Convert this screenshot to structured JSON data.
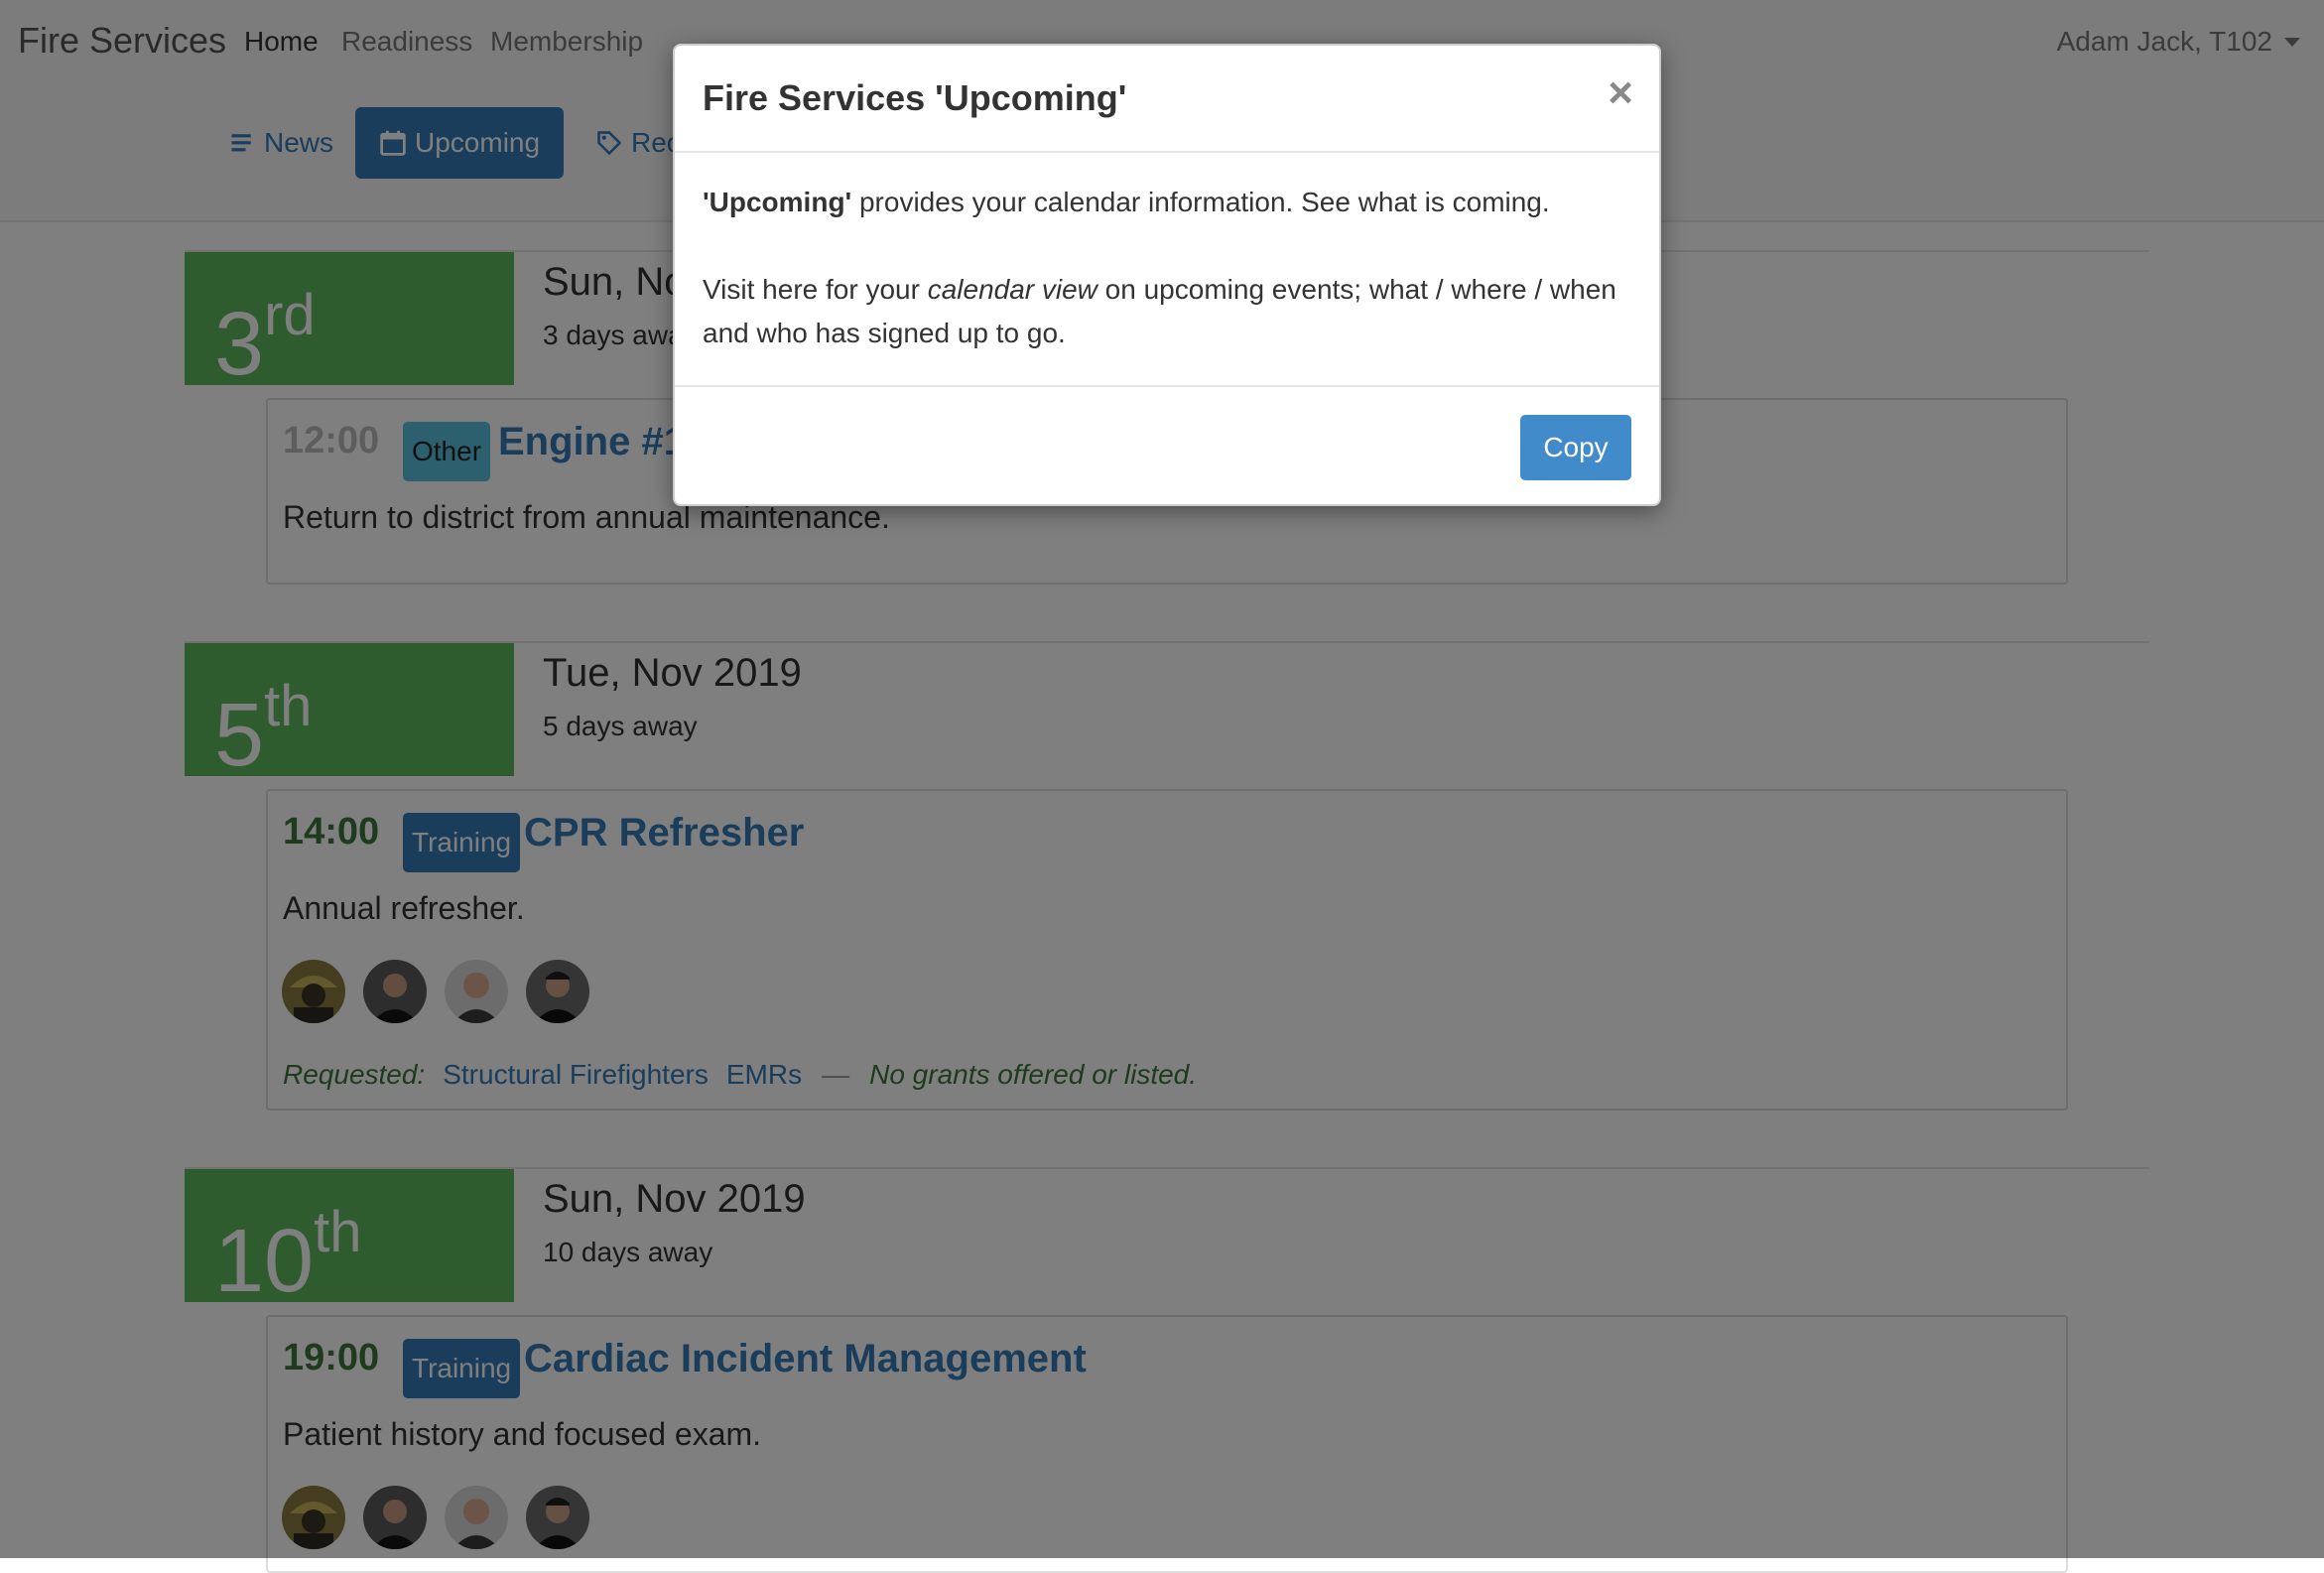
{
  "navbar": {
    "brand": "Fire Services",
    "links": [
      "Home",
      "Readiness",
      "Membership"
    ],
    "user": "Adam Jack, T102"
  },
  "subnav": {
    "tabs": [
      {
        "label": "News",
        "icon": "list-icon"
      },
      {
        "label": "Upcoming",
        "icon": "calendar-icon",
        "active": true
      },
      {
        "label": "Rec",
        "icon": "tag-icon"
      }
    ]
  },
  "days": [
    {
      "day": "3",
      "suffix": "rd",
      "title": "Sun, No",
      "subtitle": "3 days awa",
      "events": [
        {
          "time": "12:00",
          "label": "Other",
          "title": "Engine #1",
          "description": "Return to district from annual maintenance."
        }
      ]
    },
    {
      "day": "5",
      "suffix": "th",
      "title": "Tue, Nov 2019",
      "subtitle": "5 days away",
      "events": [
        {
          "time": "14:00",
          "label": "Training",
          "title": "CPR Refresher",
          "description": "Annual refresher.",
          "requested_label": "Requested:",
          "requested": [
            "Structural Firefighters",
            "EMRs"
          ],
          "grants_note": "No grants offered or listed."
        }
      ]
    },
    {
      "day": "10",
      "suffix": "th",
      "title": "Sun, Nov 2019",
      "subtitle": "10 days away",
      "events": [
        {
          "time": "19:00",
          "label": "Training",
          "title": "Cardiac Incident Management",
          "description": "Patient history and focused exam."
        }
      ]
    }
  ],
  "modal": {
    "title": "Fire Services 'Upcoming'",
    "close": "×",
    "p1_strong": "'Upcoming'",
    "p1_rest": " provides your calendar information. See what is coming.",
    "p2_a": "Visit here for your ",
    "p2_em": "calendar view",
    "p2_b": " on upcoming events; what / where / when and who has signed up to go.",
    "copy_button": "Copy"
  },
  "colors": {
    "primary": "#337ab7",
    "day_block": "#5cb85c",
    "time_green": "#3c763d",
    "label_other": "#5bc0de",
    "copy_button": "#428bca"
  }
}
